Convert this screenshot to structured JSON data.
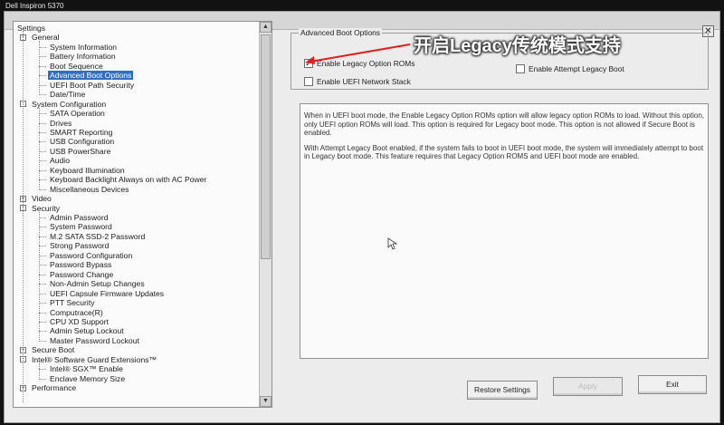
{
  "window": {
    "title": "Dell Inspiron 5370"
  },
  "tree": {
    "items": [
      {
        "label": "Settings",
        "level": 0
      },
      {
        "label": "General",
        "level": 1,
        "expander": "-"
      },
      {
        "label": "System Information",
        "level": 2
      },
      {
        "label": "Battery Information",
        "level": 2
      },
      {
        "label": "Boot Sequence",
        "level": 2
      },
      {
        "label": "Advanced Boot Options",
        "level": 2,
        "selected": true
      },
      {
        "label": "UEFI Boot Path Security",
        "level": 2
      },
      {
        "label": "Date/Time",
        "level": 2
      },
      {
        "label": "System Configuration",
        "level": 1,
        "expander": "-"
      },
      {
        "label": "SATA Operation",
        "level": 2
      },
      {
        "label": "Drives",
        "level": 2
      },
      {
        "label": "SMART Reporting",
        "level": 2
      },
      {
        "label": "USB Configuration",
        "level": 2
      },
      {
        "label": "USB PowerShare",
        "level": 2
      },
      {
        "label": "Audio",
        "level": 2
      },
      {
        "label": "Keyboard Illumination",
        "level": 2
      },
      {
        "label": "Keyboard Backlight Always on with AC Power",
        "level": 2
      },
      {
        "label": "Miscellaneous Devices",
        "level": 2
      },
      {
        "label": "Video",
        "level": 1,
        "expander": "+"
      },
      {
        "label": "Security",
        "level": 1,
        "expander": "-"
      },
      {
        "label": "Admin Password",
        "level": 2
      },
      {
        "label": "System Password",
        "level": 2
      },
      {
        "label": "M.2 SATA SSD-2 Password",
        "level": 2
      },
      {
        "label": "Strong Password",
        "level": 2
      },
      {
        "label": "Password Configuration",
        "level": 2
      },
      {
        "label": "Password Bypass",
        "level": 2
      },
      {
        "label": "Password Change",
        "level": 2
      },
      {
        "label": "Non-Admin Setup Changes",
        "level": 2
      },
      {
        "label": "UEFI Capsule Firmware Updates",
        "level": 2
      },
      {
        "label": "PTT Security",
        "level": 2
      },
      {
        "label": "Computrace(R)",
        "level": 2
      },
      {
        "label": "CPU XD Support",
        "level": 2
      },
      {
        "label": "Admin Setup Lockout",
        "level": 2
      },
      {
        "label": "Master Password Lockout",
        "level": 2
      },
      {
        "label": "Secure Boot",
        "level": 1,
        "expander": "+"
      },
      {
        "label": "Intel® Software Guard Extensions™",
        "level": 1,
        "expander": "-"
      },
      {
        "label": "Intel® SGX™ Enable",
        "level": 2
      },
      {
        "label": "Enclave Memory Size",
        "level": 2
      },
      {
        "label": "Performance",
        "level": 1,
        "expander": "+"
      }
    ]
  },
  "group": {
    "legend": "Advanced Boot Options",
    "legacy_roms": {
      "label": "Enable Legacy Option ROMs",
      "checked": true
    },
    "attempt_legacy": {
      "label": "Enable Attempt Legacy Boot",
      "checked": false
    },
    "uefi_network": {
      "label": "Enable UEFI Network Stack",
      "checked": false
    }
  },
  "description": {
    "para1": "When in UEFI boot mode, the Enable Legacy Option ROMs option will allow legacy option ROMs to load. Without this option, only UEFI option ROMs will load. This option is required for Legacy boot mode. This option is not allowed if Secure Boot is enabled.",
    "para2": "With Attempt Legacy Boot enabled, if the system fails to boot in UEFI boot mode, the system will immediately attempt to boot in Legacy boot mode. This feature requires that Legacy Option ROMS and UEFI boot mode are enabled."
  },
  "buttons": {
    "restore": "Restore Settings",
    "apply": "Apply",
    "exit": "Exit"
  },
  "annotation": {
    "text": "开启Legacy传统模式支持",
    "color": "#e02020"
  },
  "colors": {
    "selection": "#2f6ec7",
    "background": "#ececec"
  }
}
